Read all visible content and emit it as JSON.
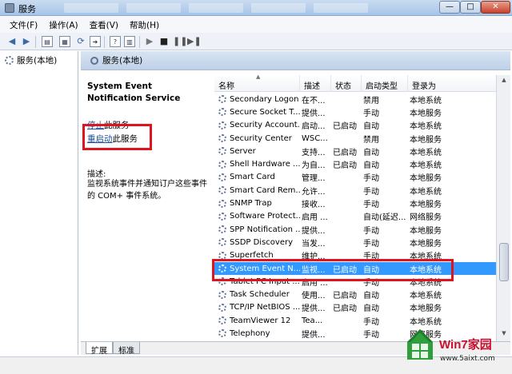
{
  "window": {
    "title": "服务",
    "min": "—",
    "max": "□",
    "close": "✕"
  },
  "menu": [
    "文件(F)",
    "操作(A)",
    "查看(V)",
    "帮助(H)"
  ],
  "tree": {
    "root": "服务(本地)"
  },
  "header": {
    "title": "服务(本地)"
  },
  "detail": {
    "service_name": "System Event Notification Service",
    "stop_link": "停止",
    "stop_suffix": "此服务",
    "restart_link": "重启动",
    "restart_suffix": "此服务",
    "desc_label": "描述:",
    "desc_text": "监视系统事件并通知订户这些事件的 COM+ 事件系统。"
  },
  "columns": [
    "名称",
    "描述",
    "状态",
    "启动类型",
    "登录为"
  ],
  "services": [
    [
      "Secondary Logon",
      "在不...",
      "",
      "禁用",
      "本地系统"
    ],
    [
      "Secure Socket T...",
      "提供...",
      "",
      "手动",
      "本地服务"
    ],
    [
      "Security Account...",
      "启动...",
      "已启动",
      "自动",
      "本地系统"
    ],
    [
      "Security Center",
      "WSC...",
      "",
      "禁用",
      "本地服务"
    ],
    [
      "Server",
      "支持...",
      "已启动",
      "自动",
      "本地系统"
    ],
    [
      "Shell Hardware ...",
      "为自...",
      "已启动",
      "自动",
      "本地系统"
    ],
    [
      "Smart Card",
      "管理...",
      "",
      "手动",
      "本地服务"
    ],
    [
      "Smart Card Rem...",
      "允许...",
      "",
      "手动",
      "本地系统"
    ],
    [
      "SNMP Trap",
      "接收...",
      "",
      "手动",
      "本地服务"
    ],
    [
      "Software Protect...",
      "启用 ...",
      "",
      "自动(延迟...",
      "网络服务"
    ],
    [
      "SPP Notification ...",
      "提供...",
      "",
      "手动",
      "本地服务"
    ],
    [
      "SSDP Discovery",
      "当发...",
      "",
      "手动",
      "本地服务"
    ],
    [
      "Superfetch",
      "维护...",
      "",
      "手动",
      "本地系统"
    ],
    [
      "System Event N...",
      "监视...",
      "已启动",
      "自动",
      "本地系统"
    ],
    [
      "Tablet PC Input ...",
      "启用 ...",
      "",
      "手动",
      "本地系统"
    ],
    [
      "Task Scheduler",
      "使用...",
      "已启动",
      "自动",
      "本地系统"
    ],
    [
      "TCP/IP NetBIOS ...",
      "提供...",
      "已启动",
      "自动",
      "本地服务"
    ],
    [
      "TeamViewer 12",
      "Tea...",
      "",
      "手动",
      "本地系统"
    ],
    [
      "Telephony",
      "提供...",
      "",
      "手动",
      "网络服务"
    ]
  ],
  "selected_index": 13,
  "tabs": [
    "扩展",
    "标准"
  ],
  "watermark": {
    "brand": "Win7家园",
    "url": "www.5aixt.com"
  },
  "colors": {
    "selection": "#3399ff",
    "highlight_box": "#e0141e",
    "link": "#1d4f9c"
  }
}
